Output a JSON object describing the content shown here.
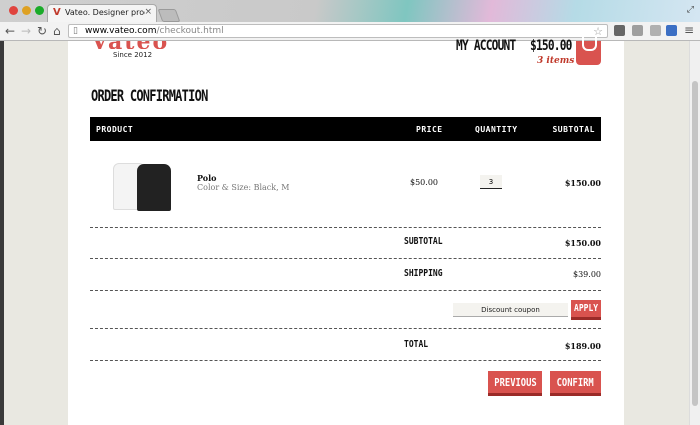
{
  "browser": {
    "tab_title": "Vateo. Designer products",
    "tab_close": "×",
    "url_host": "www.vateo.com",
    "url_path": "/checkout.html"
  },
  "icons": {
    "back": "back-arrow-icon",
    "forward": "forward-arrow-icon",
    "reload": "reload-icon",
    "home": "home-icon",
    "bookmark": "star-icon",
    "cart": "shopping-bag-icon"
  },
  "colors": {
    "accent": "#d9534f",
    "items_red": "#c0392b",
    "header_bg": "#000000"
  },
  "header": {
    "logo": "Vateo",
    "since": "Since 2012",
    "account_label": "MY ACCOUNT",
    "account_total": "$150.00",
    "items_count": "3 items"
  },
  "page_title": "ORDER CONFIRMATION",
  "table": {
    "columns": [
      "PRODUCT",
      "PRICE",
      "QUANTITY",
      "SUBTOTAL"
    ],
    "rows": [
      {
        "name": "Polo",
        "variant": "Color & Size: Black, M",
        "price": "$50.00",
        "quantity": "3",
        "subtotal": "$150.00"
      }
    ]
  },
  "summary": {
    "subtotal_label": "SUBTOTAL",
    "subtotal_value": "$150.00",
    "shipping_label": "SHIPPING",
    "shipping_value": "$39.00",
    "total_label": "TOTAL",
    "total_value": "$189.00"
  },
  "coupon": {
    "placeholder": "Discount coupon",
    "apply_label": "APPLY"
  },
  "actions": {
    "previous_label": "PREVIOUS",
    "confirm_label": "CONFIRM"
  }
}
